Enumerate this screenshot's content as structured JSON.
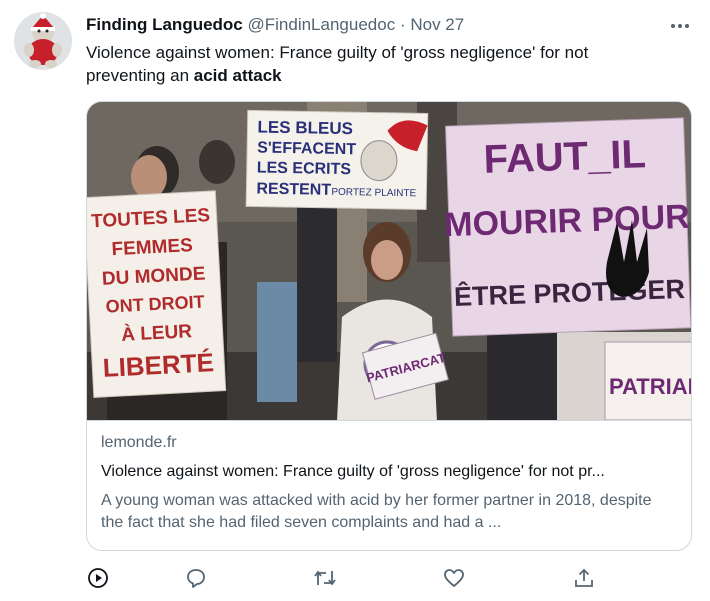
{
  "tweet": {
    "author_name": "Finding Languedoc",
    "author_handle": "@FindinLanguedoc",
    "separator": "·",
    "date": "Nov 27",
    "text_before": "Violence against women: France guilty of 'gross negligence' for not preventing an ",
    "text_bold": "acid attack"
  },
  "card": {
    "domain": "lemonde.fr",
    "title": "Violence against women: France guilty of 'gross negligence' for not pr...",
    "description": "A young woman was attacked with acid by her former partner in 2018, despite the fact that she had filed seven complaints and had a ...",
    "image": {
      "sign_left_lines": [
        "TOUTES LES",
        "FEMMES",
        "DU MONDE",
        "ONT DROIT",
        "À LEUR",
        "LIBERTÉ"
      ],
      "sign_top_lines": [
        "LES BLEUS",
        "S'EFFACENT",
        "LES ECRITS",
        "RESTENT",
        "PORTEZ PLAINTE"
      ],
      "sign_right_lines": [
        "FAUT_IL",
        "MOURIR POUR",
        "ÊTRE PROTÉGER"
      ],
      "sign_small_center": "PATRIARCAT",
      "sign_small_right": "PATRIARCA"
    }
  },
  "actions": [
    {
      "icon": "play-icon"
    },
    {
      "icon": "reply-icon"
    },
    {
      "icon": "retweet-icon"
    },
    {
      "icon": "like-icon"
    },
    {
      "icon": "share-icon"
    }
  ],
  "colors": {
    "text_primary": "#0f1419",
    "text_secondary": "#536471",
    "border": "#cfd9de",
    "sign_left_text": "#b02b2b",
    "sign_top_text": "#2a2f7a",
    "sign_right_text": "#6d2a73",
    "sign_right_bg": "#e8d6e6"
  }
}
